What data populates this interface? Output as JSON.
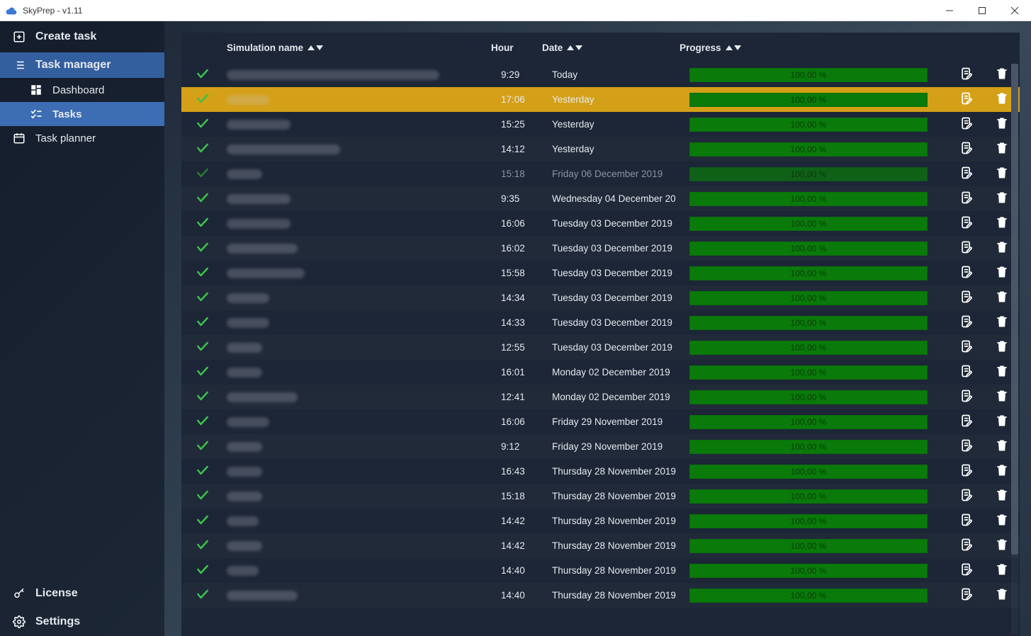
{
  "window": {
    "title": "SkyPrep - v1.11"
  },
  "sidebar": {
    "create": "Create task",
    "manager": "Task manager",
    "dashboard": "Dashboard",
    "tasks": "Tasks",
    "planner": "Task planner",
    "license": "License",
    "settings": "Settings"
  },
  "table": {
    "headers": {
      "name": "Simulation name",
      "hour": "Hour",
      "date": "Date",
      "progress": "Progress"
    },
    "rows": [
      {
        "nameWidth": 300,
        "hour": "9:29",
        "date": "Today",
        "progress": "100,00 %",
        "selected": false,
        "dim": false
      },
      {
        "nameWidth": 60,
        "hour": "17:06",
        "date": "Yesterday",
        "progress": "100,00 %",
        "selected": true,
        "dim": false
      },
      {
        "nameWidth": 90,
        "hour": "15:25",
        "date": "Yesterday",
        "progress": "100,00 %",
        "selected": false,
        "dim": false
      },
      {
        "nameWidth": 160,
        "hour": "14:12",
        "date": "Yesterday",
        "progress": "100,00 %",
        "selected": false,
        "dim": false
      },
      {
        "nameWidth": 50,
        "hour": "15:18",
        "date": "Friday 06 December 2019",
        "progress": "100,00 %",
        "selected": false,
        "dim": true
      },
      {
        "nameWidth": 90,
        "hour": "9:35",
        "date": "Wednesday 04 December 20",
        "progress": "100,00 %",
        "selected": false,
        "dim": false
      },
      {
        "nameWidth": 90,
        "hour": "16:06",
        "date": "Tuesday 03 December 2019",
        "progress": "100,00 %",
        "selected": false,
        "dim": false
      },
      {
        "nameWidth": 100,
        "hour": "16:02",
        "date": "Tuesday 03 December 2019",
        "progress": "100,00 %",
        "selected": false,
        "dim": false
      },
      {
        "nameWidth": 110,
        "hour": "15:58",
        "date": "Tuesday 03 December 2019",
        "progress": "100,00 %",
        "selected": false,
        "dim": false
      },
      {
        "nameWidth": 60,
        "hour": "14:34",
        "date": "Tuesday 03 December 2019",
        "progress": "100,00 %",
        "selected": false,
        "dim": false
      },
      {
        "nameWidth": 60,
        "hour": "14:33",
        "date": "Tuesday 03 December 2019",
        "progress": "100,00 %",
        "selected": false,
        "dim": false
      },
      {
        "nameWidth": 50,
        "hour": "12:55",
        "date": "Tuesday 03 December 2019",
        "progress": "100,00 %",
        "selected": false,
        "dim": false
      },
      {
        "nameWidth": 50,
        "hour": "16:01",
        "date": "Monday 02 December 2019",
        "progress": "100,00 %",
        "selected": false,
        "dim": false
      },
      {
        "nameWidth": 100,
        "hour": "12:41",
        "date": "Monday 02 December 2019",
        "progress": "100,00 %",
        "selected": false,
        "dim": false
      },
      {
        "nameWidth": 60,
        "hour": "16:06",
        "date": "Friday 29 November 2019",
        "progress": "100,00 %",
        "selected": false,
        "dim": false
      },
      {
        "nameWidth": 50,
        "hour": "9:12",
        "date": "Friday 29 November 2019",
        "progress": "100,00 %",
        "selected": false,
        "dim": false
      },
      {
        "nameWidth": 50,
        "hour": "16:43",
        "date": "Thursday 28 November 2019",
        "progress": "100,00 %",
        "selected": false,
        "dim": false
      },
      {
        "nameWidth": 50,
        "hour": "15:18",
        "date": "Thursday 28 November 2019",
        "progress": "100,00 %",
        "selected": false,
        "dim": false
      },
      {
        "nameWidth": 45,
        "hour": "14:42",
        "date": "Thursday 28 November 2019",
        "progress": "100,00 %",
        "selected": false,
        "dim": false
      },
      {
        "nameWidth": 50,
        "hour": "14:42",
        "date": "Thursday 28 November 2019",
        "progress": "100,00 %",
        "selected": false,
        "dim": false
      },
      {
        "nameWidth": 45,
        "hour": "14:40",
        "date": "Thursday 28 November 2019",
        "progress": "100,00 %",
        "selected": false,
        "dim": false
      },
      {
        "nameWidth": 100,
        "hour": "14:40",
        "date": "Thursday 28 November 2019",
        "progress": "100,00 %",
        "selected": false,
        "dim": false
      }
    ]
  }
}
